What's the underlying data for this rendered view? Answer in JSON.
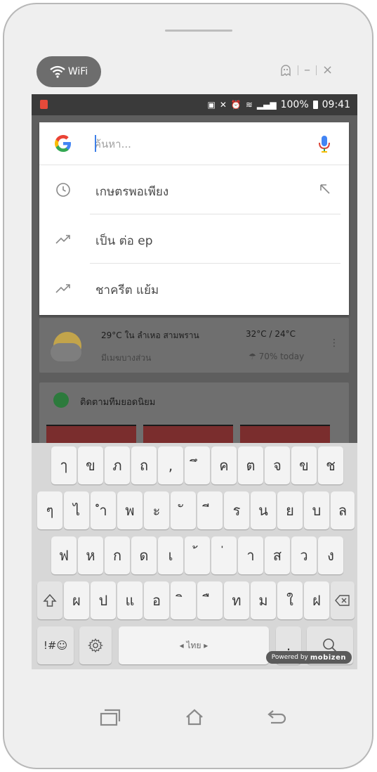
{
  "frame": {
    "wifi_label": "WiFi"
  },
  "status_bar": {
    "battery": "100%",
    "time": "09:41"
  },
  "search": {
    "placeholder": "ค้นหา..."
  },
  "suggestions": [
    {
      "text": "เกษตรพอเพียง",
      "type": "history"
    },
    {
      "text": "เป็น ต่อ ep",
      "type": "trending"
    },
    {
      "text": "ชาครีต แย้ม",
      "type": "trending"
    }
  ],
  "weather": {
    "location": "29°C ใน ลำเหอ สามพราน",
    "condition": "มีเมฆบางส่วน",
    "hi_lo": "32°C / 24°C",
    "rain": "70% today"
  },
  "follow": {
    "title": "ติดตามทีมยอดนิยม"
  },
  "keyboard": {
    "row1": [
      "ๅ",
      "ข",
      "ภ",
      "ถ",
      ",",
      "ึ",
      "ค",
      "ต",
      "จ",
      "ข",
      "ช"
    ],
    "row2": [
      "ๆ",
      "ไ",
      "ำ",
      "พ",
      "ะ",
      "ั",
      "ี",
      "ร",
      "น",
      "ย",
      "บ",
      "ล"
    ],
    "row3": [
      "ฟ",
      "ห",
      "ก",
      "ด",
      "เ",
      "้",
      "่",
      "า",
      "ส",
      "ว",
      "ง"
    ],
    "row4": [
      "ผ",
      "ป",
      "แ",
      "อ",
      "ิ",
      "ื",
      "ท",
      "ม",
      "ใ",
      "ฝ"
    ],
    "symbols_label": "!#☺",
    "space_label": "◂ ไทย ▸",
    "period": ".",
    "powered_by": "Powered by",
    "powered_brand": "mobizen"
  }
}
